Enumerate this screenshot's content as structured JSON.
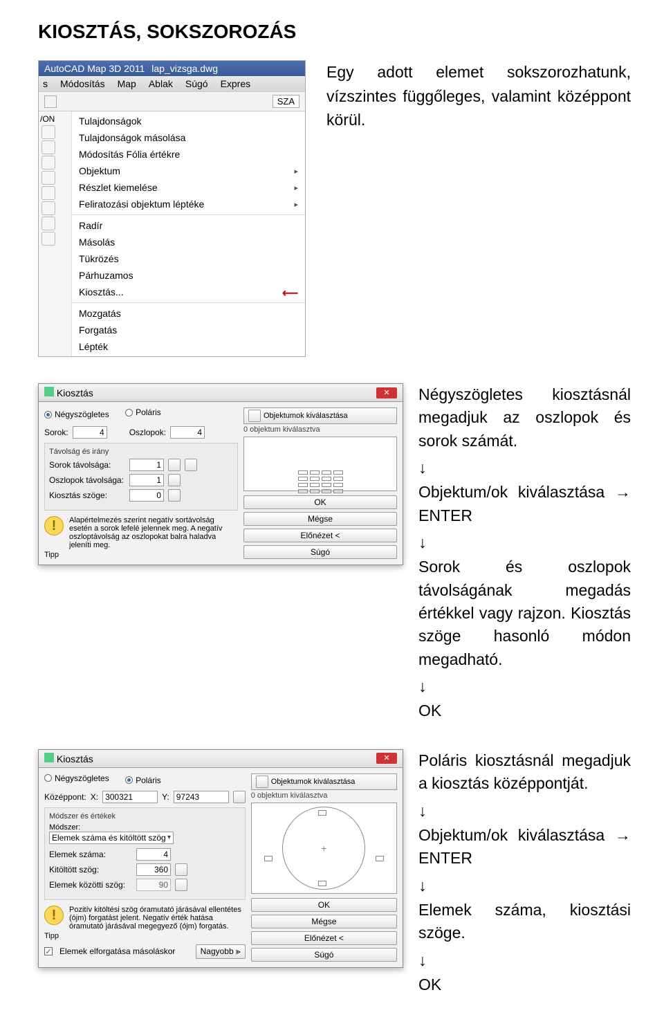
{
  "title": "KIOSZTÁS, SOKSZOROZÁS",
  "intro": "Egy adott elemet sokszorozhatunk, vízszintes függőleges, valamint középpont körül.",
  "menu_shot": {
    "app_title": "AutoCAD Map 3D 2011",
    "file": "lap_vizsga.dwg",
    "bar": [
      "s",
      "Módosítás",
      "Map",
      "Ablak",
      "Súgó",
      "Expres"
    ],
    "anno_btn": "SZA",
    "left_label": "/ON",
    "items": [
      {
        "label": "Tulajdonságok",
        "arr": false
      },
      {
        "label": "Tulajdonságok másolása",
        "arr": false
      },
      {
        "label": "Módosítás Fólia értékre",
        "arr": false
      },
      {
        "label": "Objektum",
        "arr": true
      },
      {
        "label": "Részlet kiemelése",
        "arr": true
      },
      {
        "label": "Feliratozási objektum léptéke",
        "arr": true
      }
    ],
    "items2": [
      {
        "label": "Radír",
        "arr": false
      },
      {
        "label": "Másolás",
        "arr": false
      },
      {
        "label": "Tükrözés",
        "arr": false
      },
      {
        "label": "Párhuzamos",
        "arr": false
      },
      {
        "label": "Kiosztás...",
        "arr": false,
        "highlight": true
      }
    ],
    "items3": [
      {
        "label": "Mozgatás",
        "arr": false
      },
      {
        "label": "Forgatás",
        "arr": false
      },
      {
        "label": "Lépték",
        "arr": false
      }
    ]
  },
  "rect_text": {
    "p1": "Négyszögletes kiosztásnál megadjuk az oszlopok és sorok számát.",
    "p2": "Objektum/ok kiválasztása → ENTER",
    "p3": "Sorok és oszlopok távolságának megadás értékkel vagy rajzon. Kiosztás szöge hasonló módon megadható.",
    "ok": "OK"
  },
  "polar_text": {
    "p1": "Poláris kiosztásnál megadjuk a kiosztás középpontját.",
    "p2": "Objektum/ok kiválasztása → ENTER",
    "p3": "Elemek száma, kiosztási szöge.",
    "ok": "OK"
  },
  "arrow_down": "↓",
  "dlg1": {
    "title": "Kiosztás",
    "opt_rect": "Négyszögletes",
    "opt_polar": "Poláris",
    "sorok_lbl": "Sorok:",
    "oszlopok_lbl": "Oszlopok:",
    "sorok_val": "4",
    "oszlopok_val": "4",
    "group_title": "Távolság és irány",
    "r1": "Sorok távolsága:",
    "r1v": "1",
    "r2": "Oszlopok távolsága:",
    "r2v": "1",
    "r3": "Kiosztás szöge:",
    "r3v": "0",
    "tip_lbl": "Tipp",
    "tip": "Alapértelmezés szerint negatív sortávolság esetén a sorok lefelé jelennek meg. A negatív oszloptávolság az oszlopokat balra haladva jeleníti meg.",
    "sel_btn": "Objektumok kiválasztása",
    "sel_info": "0 objektum kiválasztva",
    "btn_ok": "OK",
    "btn_cancel": "Mégse",
    "btn_prev": "Előnézet <",
    "btn_help": "Súgó"
  },
  "dlg2": {
    "title": "Kiosztás",
    "opt_rect": "Négyszögletes",
    "opt_polar": "Poláris",
    "cp_lbl": "Középpont:",
    "cp_xl": "X:",
    "cp_xv": "300321",
    "cp_yl": "Y:",
    "cp_yv": "97243",
    "method_lbl": "Módszer és értékek",
    "method_sub": "Módszer:",
    "method_val": "Elemek száma és kitöltött szög",
    "r1": "Elemek száma:",
    "r1v": "4",
    "r2": "Kitöltött szög:",
    "r2v": "360",
    "r3": "Elemek közötti szög:",
    "r3v": "90",
    "tip_lbl": "Tipp",
    "tip": "Pozitív kitöltési szög óramutató járásával ellentétes (ójm) forgatást jelent. Negatív érték hatása óramutató járásával megegyező (ójm) forgatás.",
    "chk": "Elemek elforgatása másoláskor",
    "more": "Nagyobb ⪢",
    "sel_btn": "Objektumok kiválasztása",
    "sel_info": "0 objektum kiválasztva",
    "btn_ok": "OK",
    "btn_cancel": "Mégse",
    "btn_prev": "Előnézet <",
    "btn_help": "Súgó"
  }
}
